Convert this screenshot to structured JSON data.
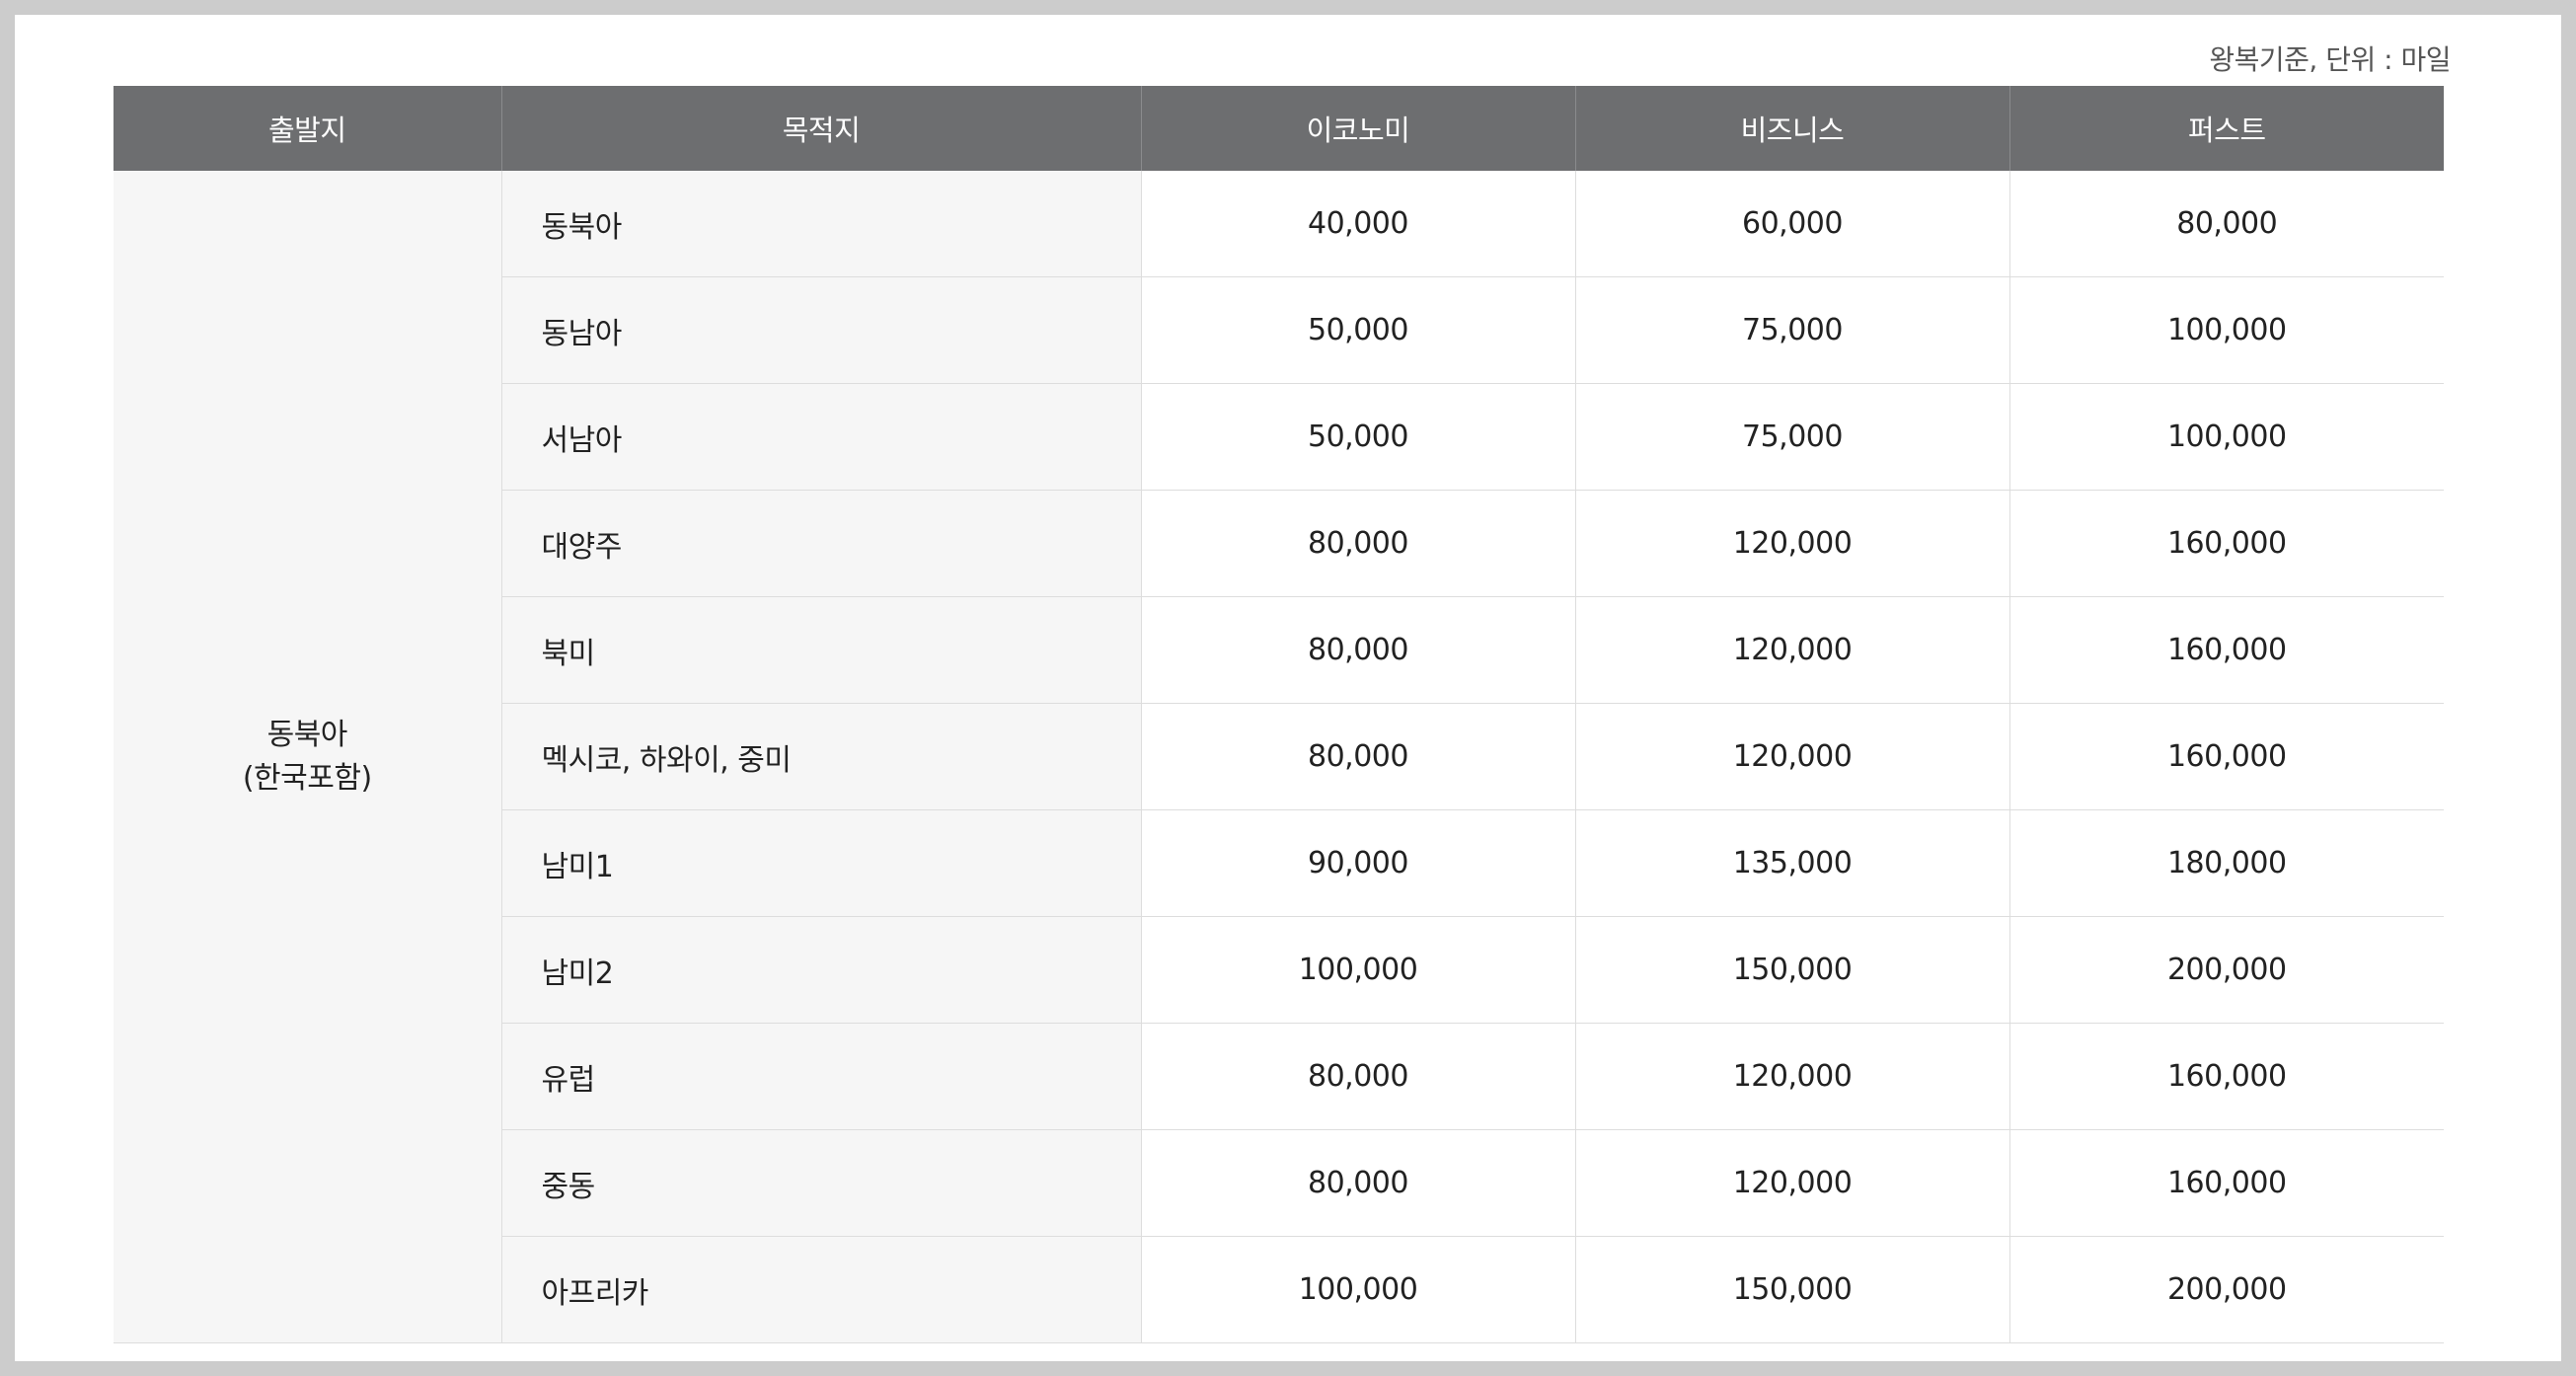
{
  "note": "왕복기준, 단위 : 마일",
  "table": {
    "headers": [
      "출발지",
      "목적지",
      "이코노미",
      "비즈니스",
      "퍼스트"
    ],
    "origin": [
      "동북아",
      "(한국포함)"
    ],
    "rows": [
      {
        "destination": "동북아",
        "economy": "40,000",
        "business": "60,000",
        "first": "80,000"
      },
      {
        "destination": "동남아",
        "economy": "50,000",
        "business": "75,000",
        "first": "100,000"
      },
      {
        "destination": "서남아",
        "economy": "50,000",
        "business": "75,000",
        "first": "100,000"
      },
      {
        "destination": "대양주",
        "economy": "80,000",
        "business": "120,000",
        "first": "160,000"
      },
      {
        "destination": "북미",
        "economy": "80,000",
        "business": "120,000",
        "first": "160,000"
      },
      {
        "destination": "멕시코, 하와이, 중미",
        "economy": "80,000",
        "business": "120,000",
        "first": "160,000"
      },
      {
        "destination": "남미1",
        "economy": "90,000",
        "business": "135,000",
        "first": "180,000"
      },
      {
        "destination": "남미2",
        "economy": "100,000",
        "business": "150,000",
        "first": "200,000"
      },
      {
        "destination": "유럽",
        "economy": "80,000",
        "business": "120,000",
        "first": "160,000"
      },
      {
        "destination": "중동",
        "economy": "80,000",
        "business": "120,000",
        "first": "160,000"
      },
      {
        "destination": "아프리카",
        "economy": "100,000",
        "business": "150,000",
        "first": "200,000"
      }
    ]
  },
  "colors": {
    "header_bg": "#6d6e70",
    "header_text": "#ffffff",
    "shaded_cell_bg": "#f6f6f6",
    "border": "#dddddd",
    "frame_bg": "#cccccc"
  }
}
